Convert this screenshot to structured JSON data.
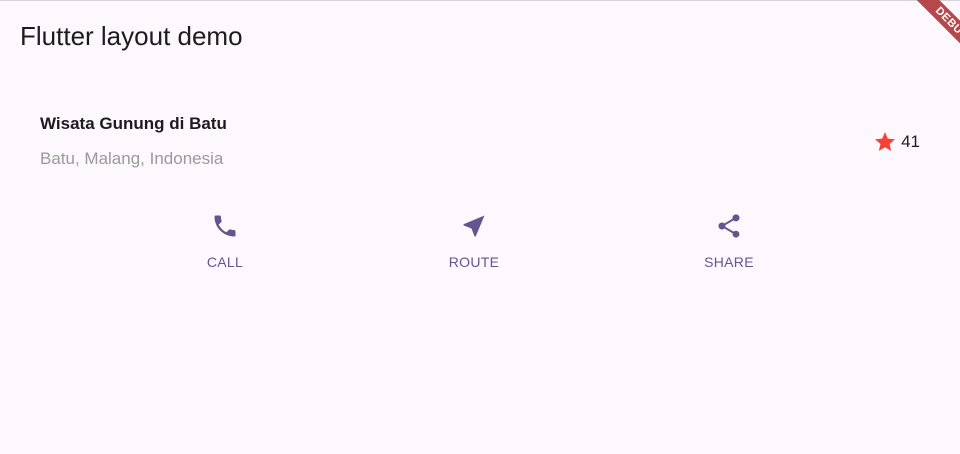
{
  "app_bar": {
    "title": "Flutter layout demo"
  },
  "place": {
    "name": "Wisata Gunung di Batu",
    "location": "Batu, Malang, Indonesia",
    "rating_icon": "star-icon",
    "rating_count": "41"
  },
  "actions": [
    {
      "label": "CALL",
      "icon": "phone-icon"
    },
    {
      "label": "ROUTE",
      "icon": "navigation-icon"
    },
    {
      "label": "SHARE",
      "icon": "share-icon"
    }
  ],
  "debug_banner": {
    "label": "DEBUG"
  },
  "colors": {
    "background": "#fdf7fe",
    "accent": "#65558f",
    "star": "#f44336",
    "debug_ribbon": "#b5484b",
    "secondary_text": "#9a9a9a"
  }
}
